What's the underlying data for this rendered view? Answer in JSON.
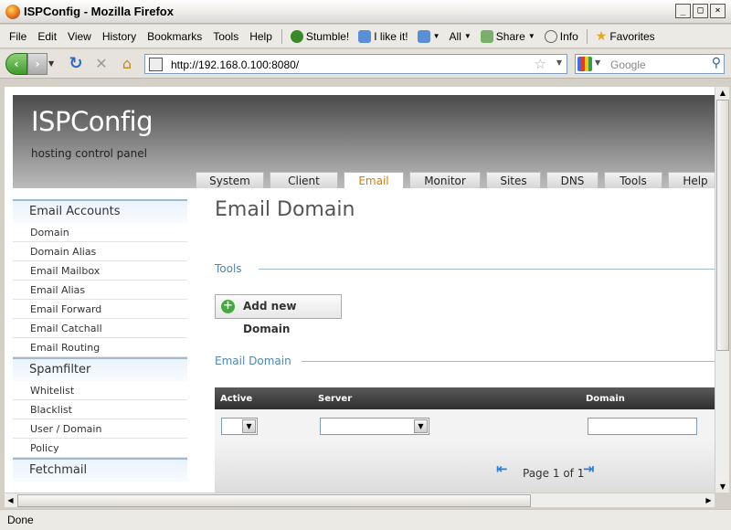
{
  "window": {
    "title": "ISPConfig - Mozilla Firefox"
  },
  "menu": [
    "File",
    "Edit",
    "View",
    "History",
    "Bookmarks",
    "Tools",
    "Help"
  ],
  "toolbar": {
    "stumble": "Stumble!",
    "ilike": "I like it!",
    "all": "All",
    "share": "Share",
    "info": "Info",
    "favorites": "Favorites"
  },
  "nav": {
    "url": "http://192.168.0.100:8080/",
    "search_placeholder": "Google"
  },
  "app": {
    "logo": "ISPConfig",
    "tagline": "hosting control panel"
  },
  "tabs": [
    {
      "label": "System"
    },
    {
      "label": "Client"
    },
    {
      "label": "Email"
    },
    {
      "label": "Monitor"
    },
    {
      "label": "Sites"
    },
    {
      "label": "DNS"
    },
    {
      "label": "Tools"
    },
    {
      "label": "Help"
    }
  ],
  "active_tab": "Email",
  "sidebar": {
    "sections": [
      {
        "title": "Email Accounts",
        "items": [
          "Domain",
          "Domain Alias",
          "Email Mailbox",
          "Email Alias",
          "Email Forward",
          "Email Catchall",
          "Email Routing"
        ]
      },
      {
        "title": "Spamfilter",
        "items": [
          "Whitelist",
          "Blacklist",
          "User / Domain",
          "Policy"
        ]
      },
      {
        "title": "Fetchmail",
        "items": []
      }
    ]
  },
  "main": {
    "title": "Email Domain",
    "tools_legend": "Tools",
    "add_button": "Add new Domain",
    "list_legend": "Email Domain",
    "columns": [
      "Active",
      "Server",
      "Domain"
    ],
    "pager": "Page 1 of 1"
  },
  "status": "Done",
  "colors": {
    "accent_tab": "#e07a00",
    "legend": "#4d87b4",
    "add_icon": "#45a940"
  }
}
